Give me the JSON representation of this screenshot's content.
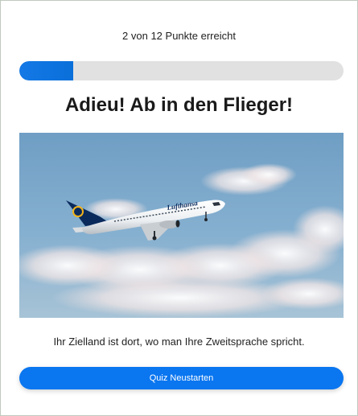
{
  "quiz": {
    "score_text": "2 von 12 Punkte erreicht",
    "progress": 0.167,
    "headline": "Adieu! Ab in den Flieger!",
    "message": "Ihr Zielland ist dort, wo man Ihre Zweitsprache spricht.",
    "restart_label": "Quiz Neustarten"
  },
  "photo": {
    "alt": "airplane",
    "airline_text": "Lufthansa"
  },
  "colors": {
    "accent": "#0a76f0",
    "progress_track": "#e1e1e1",
    "text": "#222222"
  }
}
